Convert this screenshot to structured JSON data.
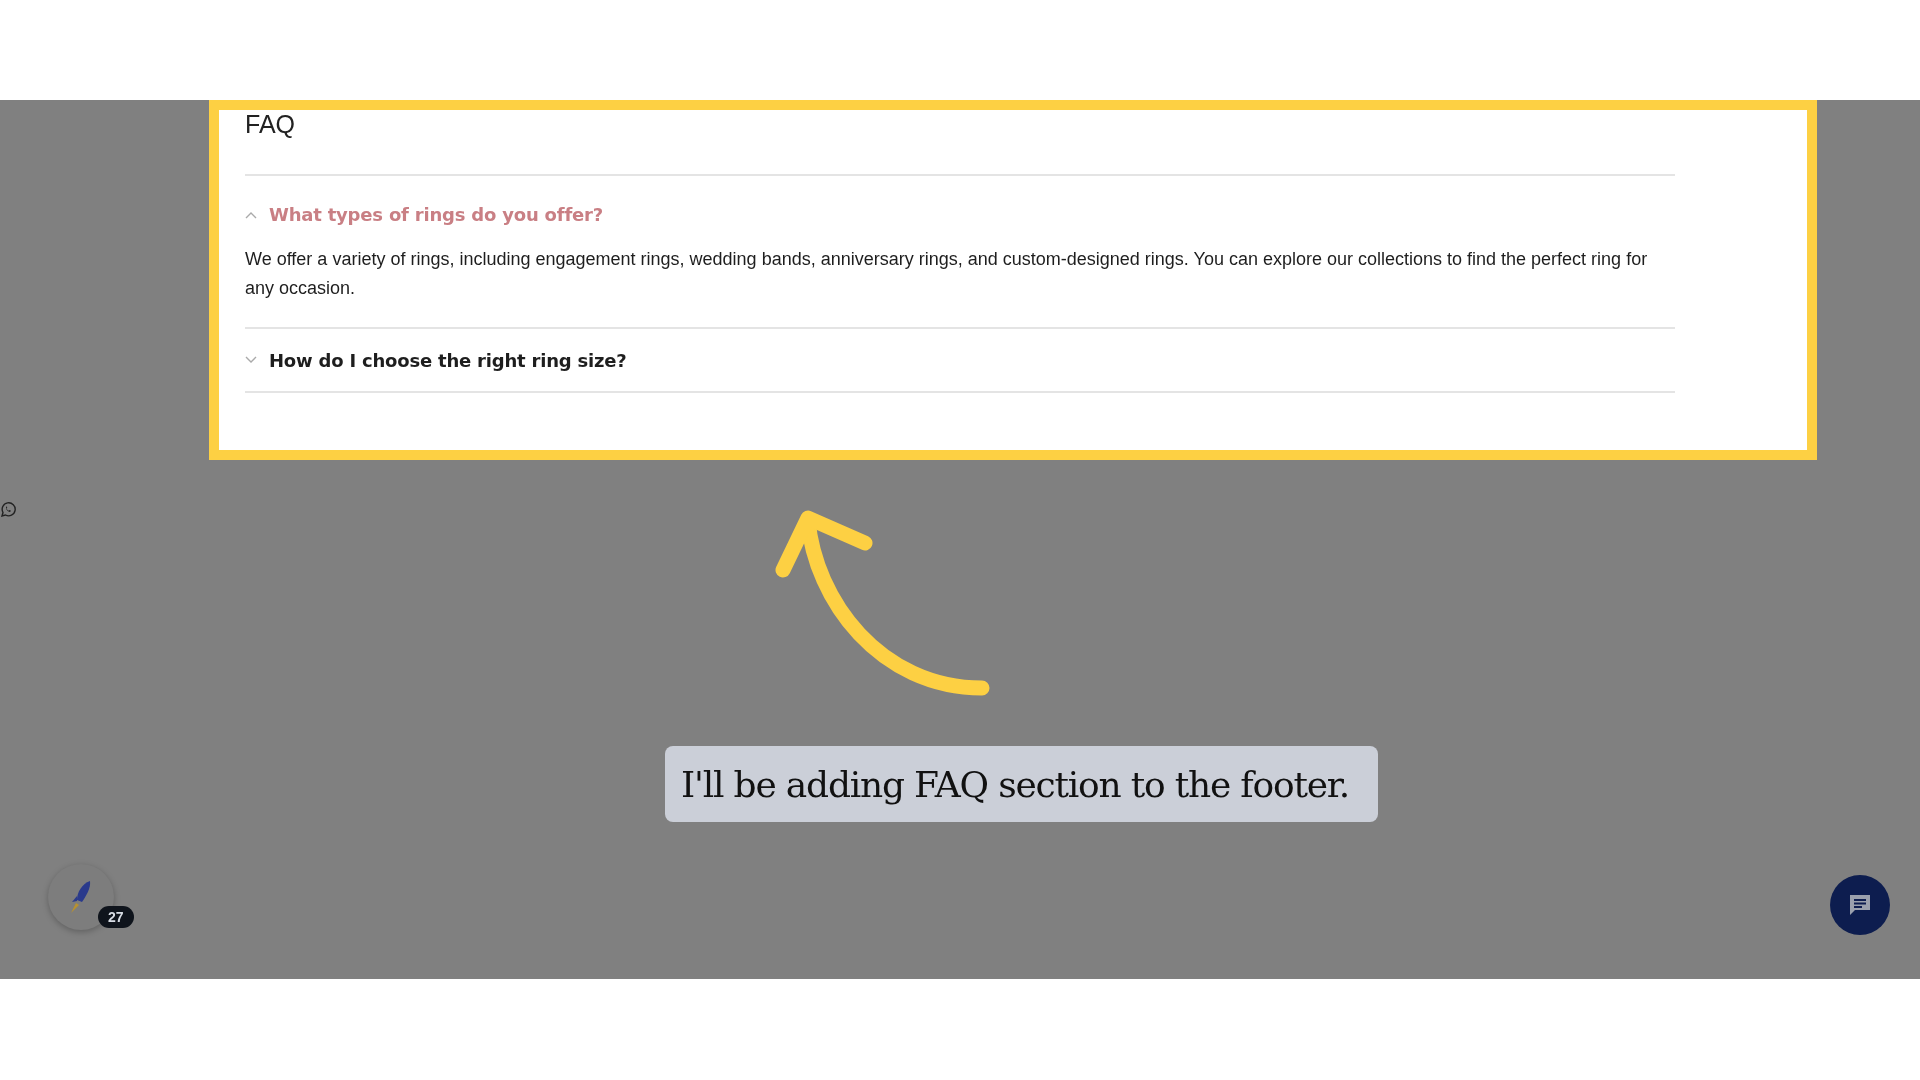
{
  "faq": {
    "title": "FAQ",
    "items": [
      {
        "question": "What types of rings do you offer?",
        "expanded": true,
        "answer": "We offer a variety of rings, including engagement rings, wedding bands, anniversary rings, and custom-designed rings. You can explore our collections to find the perfect ring for any occasion."
      },
      {
        "question": "How do I choose the right ring size?",
        "expanded": false
      }
    ]
  },
  "caption": "I'll be adding FAQ section to the footer.",
  "launcher": {
    "badge": "27"
  }
}
